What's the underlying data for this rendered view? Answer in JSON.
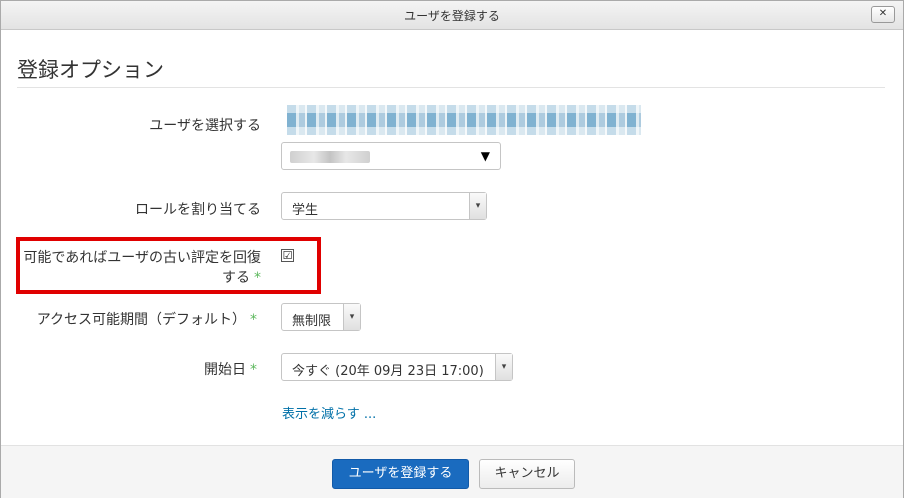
{
  "dialog": {
    "title": "ユーザを登録する",
    "close_label": "✕"
  },
  "section": {
    "title": "登録オプション"
  },
  "form": {
    "select_user_label": "ユーザを選択する",
    "role_label": "ロールを割り当てる",
    "role_value": "学生",
    "recover_grades_label_line1": "可能であればユーザの古い評定を回復",
    "recover_grades_label_line2": "する",
    "recover_grades_checked": true,
    "recover_grades_mark": "☑",
    "duration_label": "アクセス可能期間（デフォルト）",
    "duration_value": "無制限",
    "start_label": "開始日",
    "start_value": "今すぐ (20年 09月 23日 17:00)",
    "required_mark": "*",
    "show_less_link": "表示を減らす ..."
  },
  "footer": {
    "enrol_button": "ユーザを登録する",
    "cancel_button": "キャンセル"
  },
  "colors": {
    "primary": "#1a6bbf",
    "required": "#5cb85c",
    "highlight": "#e00000",
    "link": "#0070a8"
  }
}
